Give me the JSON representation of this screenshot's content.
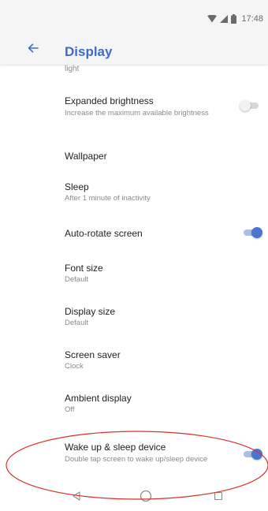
{
  "status_bar": {
    "time": "17:48",
    "icons": [
      "wifi-icon",
      "cell-signal-icon",
      "battery-icon"
    ]
  },
  "app_bar": {
    "back_icon": "arrow-left-icon",
    "title": "Display"
  },
  "partial_item_summary": "light",
  "settings": {
    "expanded_brightness": {
      "title": "Expanded brightness",
      "summary": "Increase the maximum available brightness",
      "toggle": "off"
    },
    "wallpaper": {
      "title": "Wallpaper"
    },
    "sleep": {
      "title": "Sleep",
      "summary": "After 1 minute of inactivity"
    },
    "auto_rotate": {
      "title": "Auto-rotate screen",
      "toggle": "on"
    },
    "font_size": {
      "title": "Font size",
      "summary": "Default"
    },
    "display_size": {
      "title": "Display size",
      "summary": "Default"
    },
    "screen_saver": {
      "title": "Screen saver",
      "summary": "Clock"
    },
    "ambient_display": {
      "title": "Ambient display",
      "summary": "Off"
    },
    "wake_sleep": {
      "title": "Wake up & sleep device",
      "summary": "Double tap screen to wake up/sleep device",
      "toggle": "on"
    }
  },
  "nav_bar": {
    "buttons": [
      "back-triangle-icon",
      "home-circle-icon",
      "recents-square-icon"
    ]
  },
  "colors": {
    "accent": "#3d6cc6",
    "switch_on_thumb": "#4a76cf",
    "annotation_ellipse": "#d9302c"
  }
}
